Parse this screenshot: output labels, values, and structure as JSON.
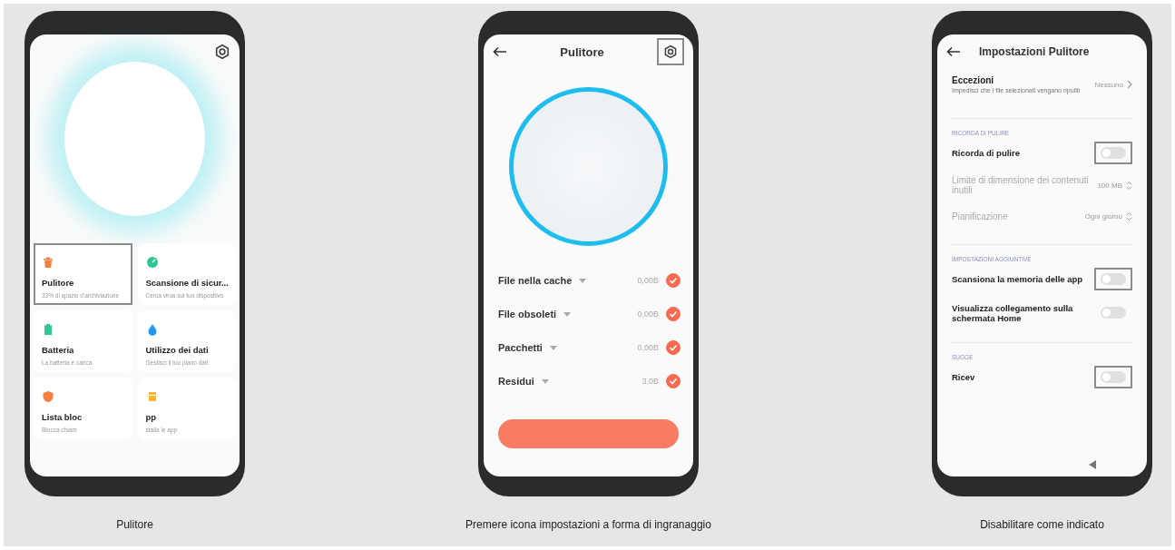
{
  "phones": [
    {
      "kind": "home",
      "caption": "Pulitore",
      "gear_highlighted": false,
      "tiles": [
        {
          "title": "Pulitore",
          "subtitle": "33% di spazio d'archiviazione",
          "color": "#f5803e",
          "highlighted": true
        },
        {
          "title": "Scansione di sicur...",
          "subtitle": "Cerca virus sul tuo dispositivo",
          "color": "#2ec795",
          "highlighted": false
        },
        {
          "title": "Batteria",
          "subtitle": "La batteria è carica",
          "color": "#2ec795",
          "highlighted": false
        },
        {
          "title": "Utilizzo dei dati",
          "subtitle": "Gestisci il tuo piano dati",
          "color": "#2196f3",
          "highlighted": false
        },
        {
          "title": "Lista bloc",
          "subtitle": "Blocca chiam",
          "color": "#f5803e",
          "highlighted": false
        },
        {
          "title": "pp",
          "subtitle": "stalla le app",
          "color": "#f7b52c",
          "highlighted": false
        }
      ]
    },
    {
      "kind": "cleaner",
      "caption": "Premere icona impostazioni a forma di ingranaggio",
      "title": "Pulitore",
      "gear_highlighted": true,
      "items": [
        {
          "label": "File nella cache",
          "size": "0,00B",
          "checked": true
        },
        {
          "label": "File obsoleti",
          "size": "0,00B",
          "checked": true
        },
        {
          "label": "Pacchetti",
          "size": "0,00B",
          "checked": true
        },
        {
          "label": "Residui",
          "size": "3,0B",
          "checked": true
        }
      ]
    },
    {
      "kind": "settings",
      "caption": "Disabilitare come indicato",
      "title": "Impostazioni Pulitore",
      "sections": [
        {
          "items": [
            {
              "kind": "link",
              "title": "Eccezioni",
              "subtitle": "Impedisci che i file selezionati vengano ripuliti",
              "value": "Nessuno"
            }
          ]
        },
        {
          "header": "RICORDA DI PULIRE",
          "items": [
            {
              "kind": "toggle",
              "title": "Ricorda di pulire",
              "on": false,
              "highlighted": true
            },
            {
              "kind": "select",
              "title": "Limite di dimensione dei contenuti inutili",
              "value": "100 MB",
              "disabled": true
            },
            {
              "kind": "select",
              "title": "Pianificazione",
              "value": "Ogni giorno",
              "disabled": true
            }
          ]
        },
        {
          "header": "IMPOSTAZIONI AGGIUNTIVE",
          "items": [
            {
              "kind": "toggle",
              "title": "Scansiona la memoria delle app",
              "on": false,
              "highlighted": true
            },
            {
              "kind": "toggle",
              "title": "Visualizza collegamento sulla schermata Home",
              "on": false,
              "highlighted": false
            }
          ]
        },
        {
          "header": "SUGGE",
          "items": [
            {
              "kind": "toggle",
              "title": "Ricev",
              "on": false,
              "highlighted": true
            }
          ]
        }
      ]
    }
  ]
}
